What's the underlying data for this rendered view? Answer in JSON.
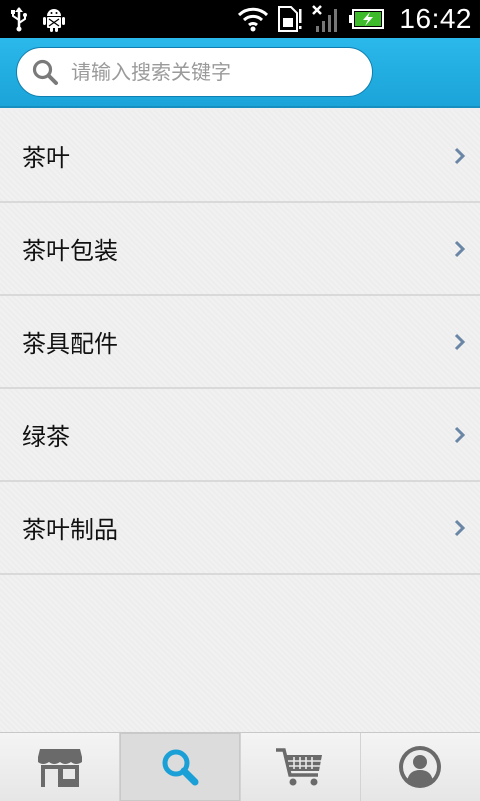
{
  "status_bar": {
    "time": "16:42",
    "icons": [
      "usb-icon",
      "android-debug-icon",
      "wifi-icon",
      "sim-icon",
      "no-signal-icon",
      "battery-charging-icon"
    ]
  },
  "search": {
    "placeholder": "请输入搜索关键字",
    "value": ""
  },
  "categories": [
    {
      "label": "茶叶"
    },
    {
      "label": "茶叶包装"
    },
    {
      "label": "茶具配件"
    },
    {
      "label": "绿茶"
    },
    {
      "label": "茶叶制品"
    }
  ],
  "tabs": [
    {
      "icon": "store-icon",
      "active": false
    },
    {
      "icon": "search-icon",
      "active": true
    },
    {
      "icon": "cart-icon",
      "active": false
    },
    {
      "icon": "profile-icon",
      "active": false
    }
  ],
  "colors": {
    "header": "#1aa3d8",
    "active_tab_icon": "#1a9fd6",
    "inactive_tab_icon": "#6a6a6a",
    "chevron": "#6a86a6"
  }
}
